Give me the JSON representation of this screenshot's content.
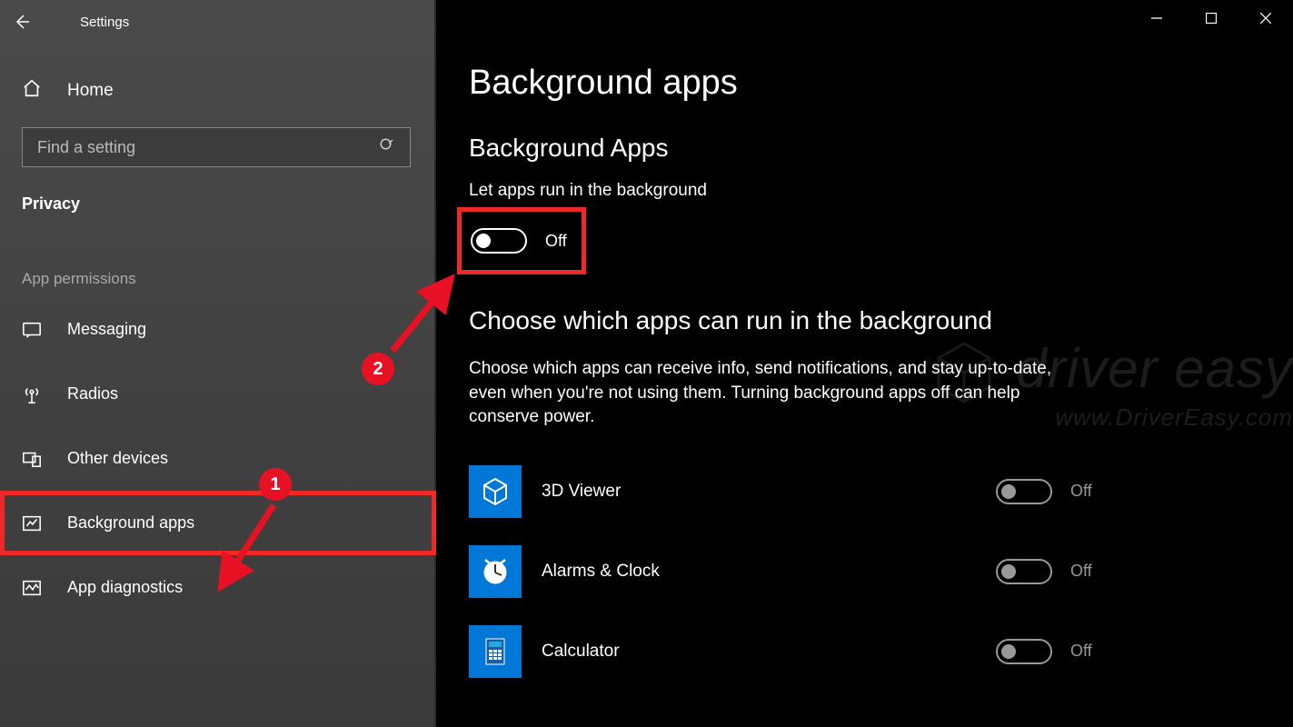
{
  "titlebar": {
    "title": "Settings"
  },
  "sidebar": {
    "home_label": "Home",
    "search_placeholder": "Find a setting",
    "category_label": "Privacy",
    "section_label": "App permissions",
    "items": [
      {
        "label": "Messaging"
      },
      {
        "label": "Radios"
      },
      {
        "label": "Other devices"
      },
      {
        "label": "Background apps"
      },
      {
        "label": "App diagnostics"
      }
    ]
  },
  "main": {
    "heading": "Background apps",
    "subheading": "Background Apps",
    "let_label": "Let apps run in the background",
    "master_toggle_state": "Off",
    "choose_heading": "Choose which apps can run in the background",
    "description": "Choose which apps can receive info, send notifications, and stay up-to-date, even when you're not using them. Turning background apps off can help conserve power.",
    "apps": [
      {
        "name": "3D Viewer",
        "state": "Off"
      },
      {
        "name": "Alarms & Clock",
        "state": "Off"
      },
      {
        "name": "Calculator",
        "state": "Off"
      }
    ]
  },
  "annotations": {
    "badge1": "1",
    "badge2": "2"
  },
  "watermark": {
    "line1": "driver easy",
    "line2": "www.DriverEasy.com"
  },
  "colors": {
    "accent": "#0078d7",
    "highlight": "#f02828"
  }
}
